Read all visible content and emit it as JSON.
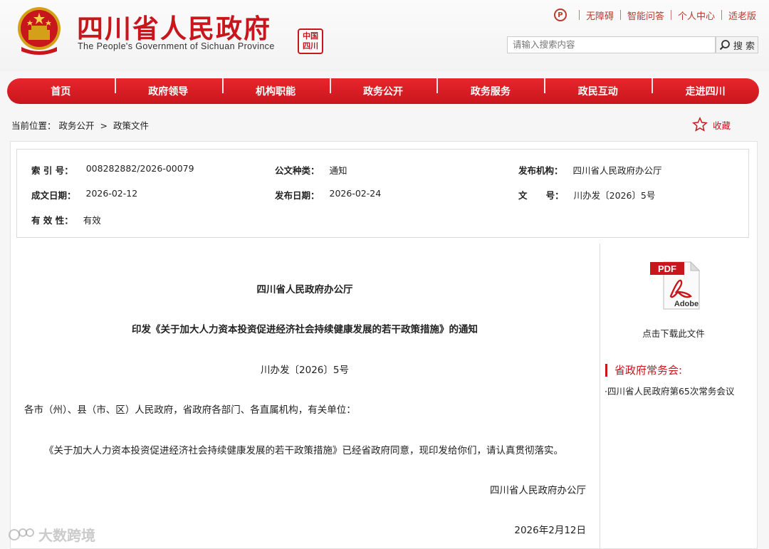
{
  "header": {
    "title_cn": "四川省人民政府",
    "title_en": "The People's Government of Sichuan Province",
    "seal_text": "中国四川",
    "top_links": [
      "无障碍",
      "智能问答",
      "个人中心",
      "适老版"
    ],
    "search_placeholder": "请输入搜索内容",
    "search_button": "搜 索"
  },
  "nav": {
    "items": [
      "首页",
      "政府领导",
      "机构职能",
      "政务公开",
      "政务服务",
      "政民互动",
      "走进四川"
    ]
  },
  "breadcrumb": {
    "prefix": "当前位置：",
    "path1": "政务公开",
    "separator": ">",
    "path2": "政策文件"
  },
  "favorite_label": "收藏",
  "meta": {
    "index_label": "索 引 号：",
    "index_value": "008282882/2026-00079",
    "type_label": "公文种类：",
    "type_value": "通知",
    "issuer_label": "发布机构：",
    "issuer_value": "四川省人民政府办公厅",
    "created_label": "成文日期：",
    "created_value": "2026-02-12",
    "published_label": "发布日期：",
    "published_value": "2026-02-24",
    "docno_label": "文      号：",
    "docno_value": "川办发〔2026〕5号",
    "validity_label": "有 效 性：",
    "validity_value": "有效"
  },
  "doc": {
    "issuer": "四川省人民政府办公厅",
    "title": "印发《关于加大人力资本投资促进经济社会持续健康发展的若干政策措施》的通知",
    "number": "川办发〔2026〕5号",
    "recipients": "各市（州）、县（市、区）人民政府，省政府各部门、各直属机构，有关单位：",
    "body": "《关于加大人力资本投资促进经济社会持续健康发展的若干政策措施》已经省政府同意，现印发给你们，请认真贯彻落实。",
    "sign_org": "四川省人民政府办公厅",
    "sign_date": "2026年2月12日"
  },
  "sidebar": {
    "pdf_badge": "PDF",
    "pdf_brand": "Adobe",
    "download_label": "点击下载此文件",
    "heading": "省政府常务会:",
    "item": "·四川省人民政府第65次常务会议"
  },
  "watermark": "大数跨境",
  "colors": {
    "brand_red": "#c8161d",
    "nav_red": "#e8262c"
  }
}
